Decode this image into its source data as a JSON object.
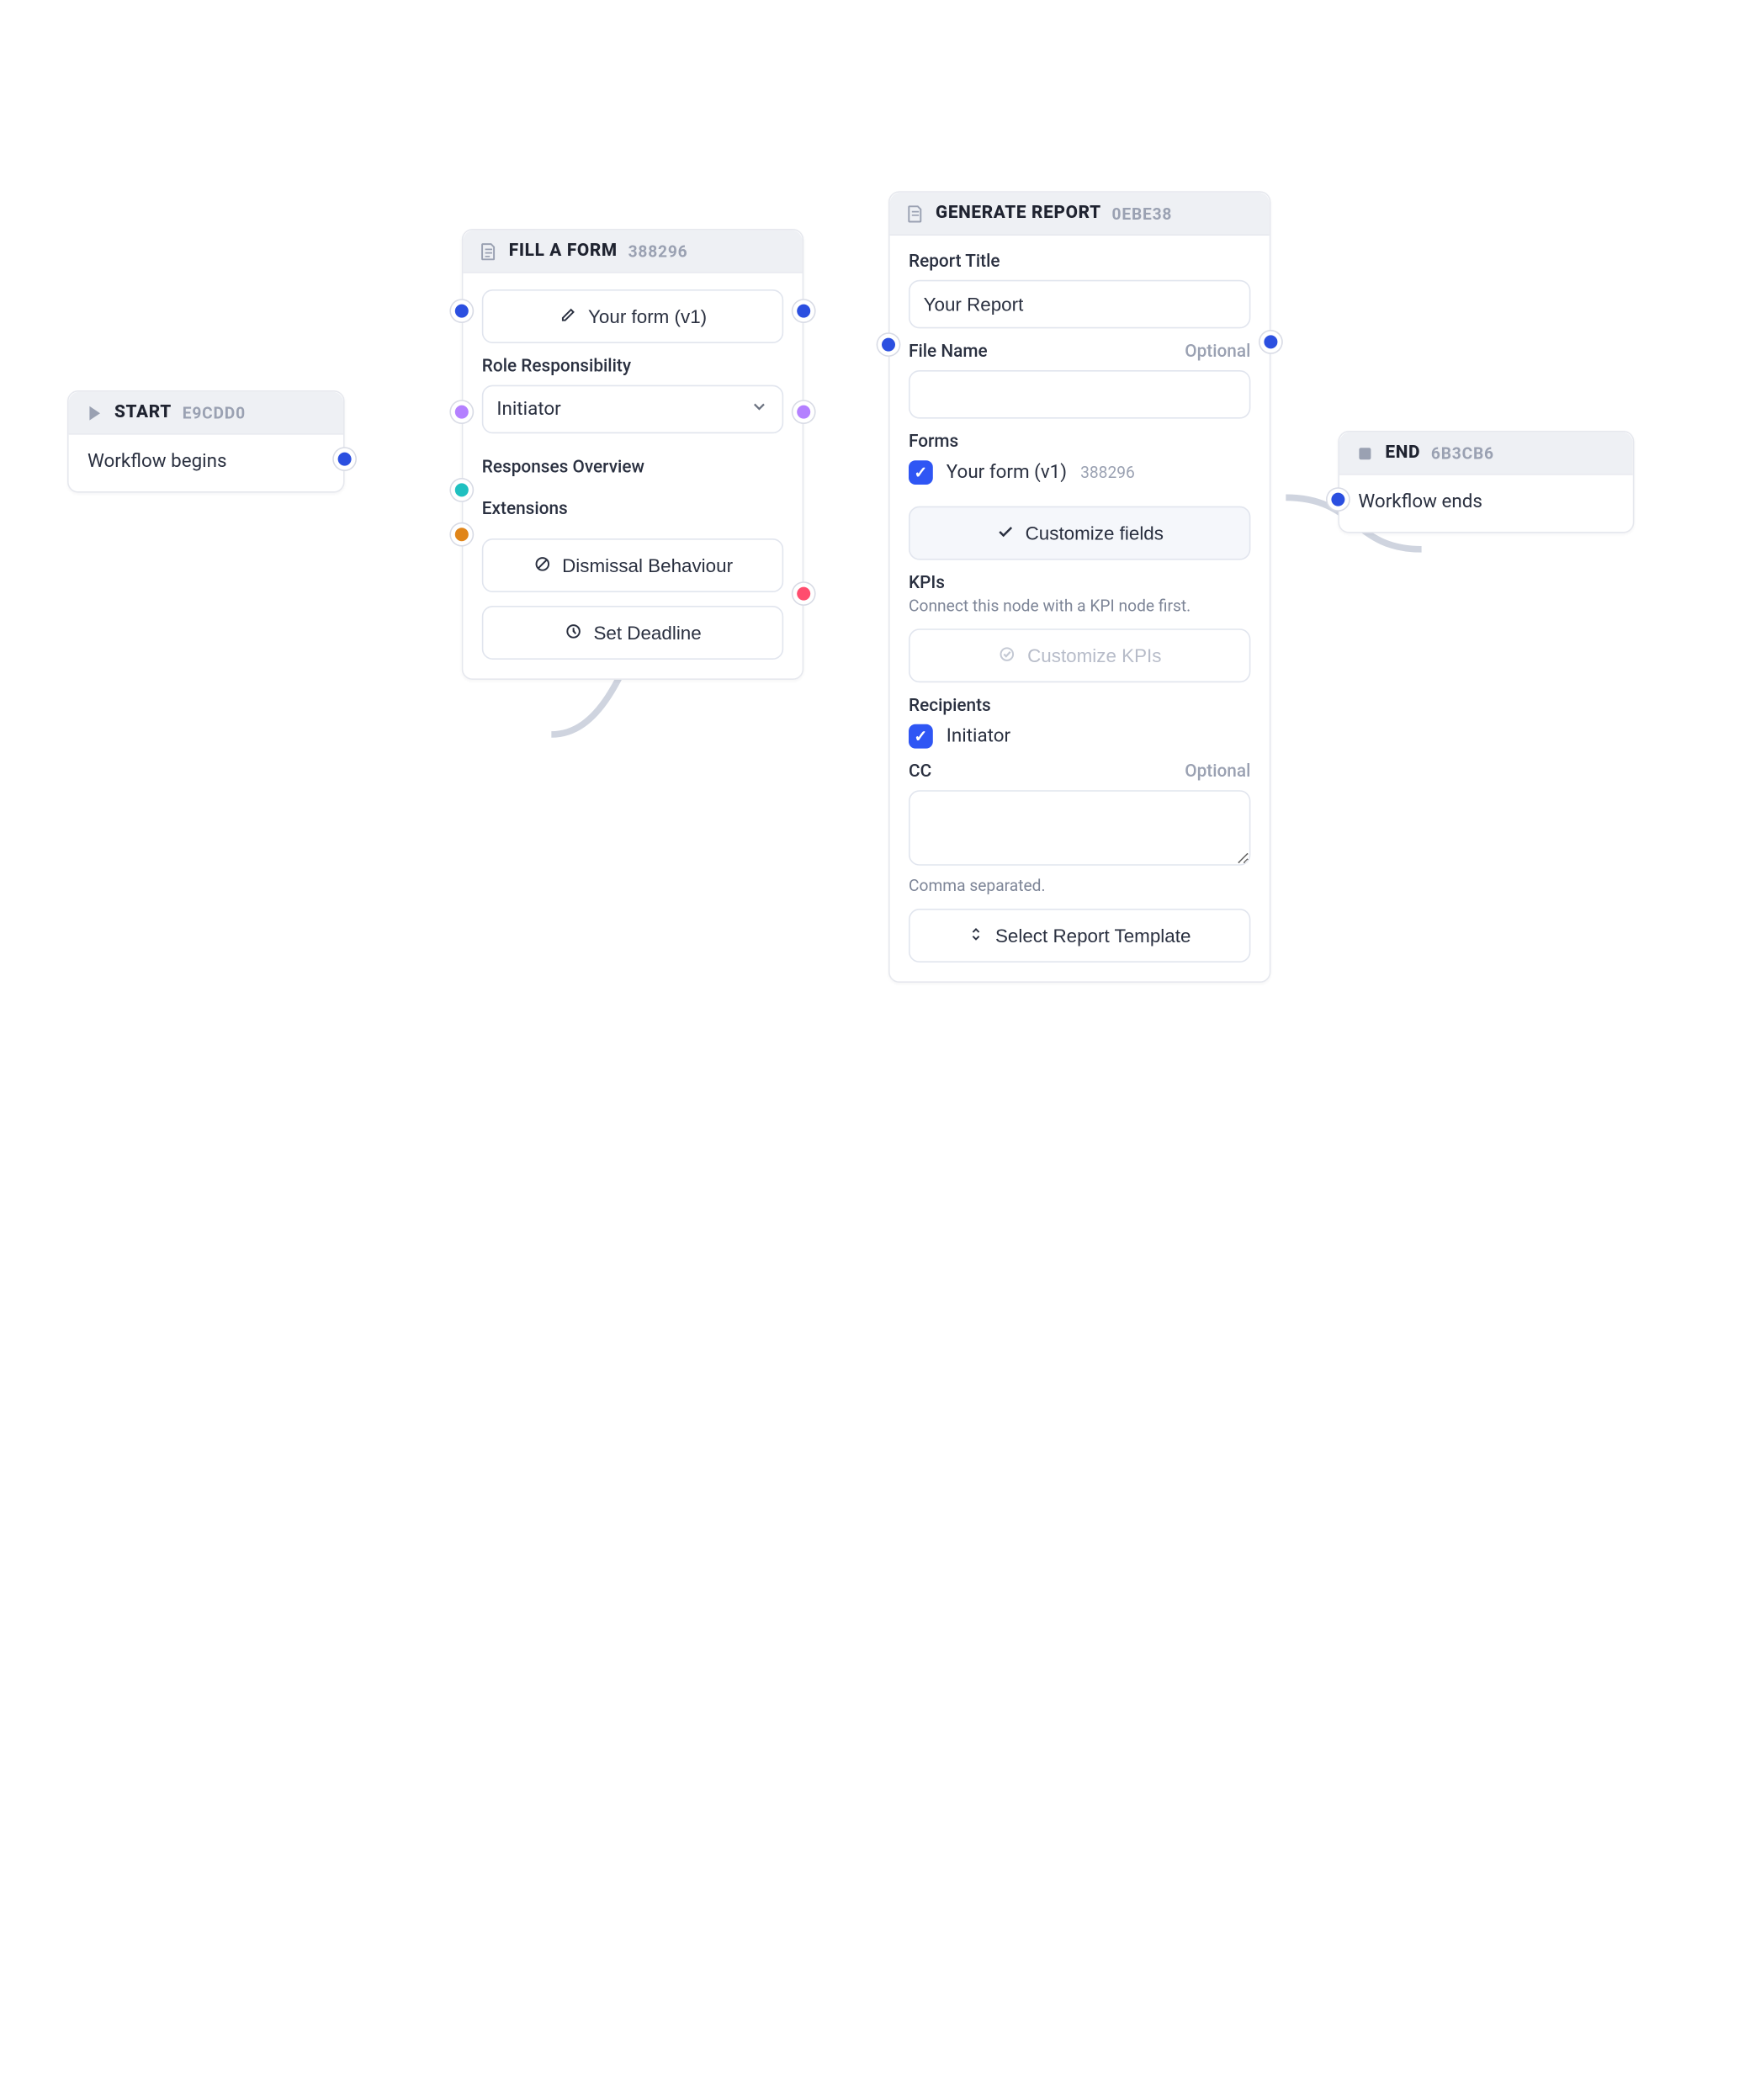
{
  "start": {
    "title": "START",
    "hash": "E9CDD0",
    "body": "Workflow begins"
  },
  "form": {
    "title": "FILL A FORM",
    "hash": "388296",
    "formButton": "Your form (v1)",
    "roleLabel": "Role Responsibility",
    "roleValue": "Initiator",
    "responsesLabel": "Responses Overview",
    "extensionsLabel": "Extensions",
    "dismissalBtn": "Dismissal Behaviour",
    "deadlineBtn": "Set Deadline"
  },
  "gen": {
    "title": "GENERATE REPORT",
    "hash": "0EBE38",
    "reportTitleLabel": "Report Title",
    "reportTitleValue": "Your Report",
    "fileNameLabel": "File Name",
    "fileNameOptional": "Optional",
    "formsLabel": "Forms",
    "formCheckboxLabel": "Your form (v1)",
    "formCheckboxHash": "388296",
    "customizeFieldsBtn": "Customize fields",
    "kpisLabel": "KPIs",
    "kpisHint": "Connect this node with a KPI node first.",
    "customizeKpisBtn": "Customize KPIs",
    "recipientsLabel": "Recipients",
    "recipientInitiator": "Initiator",
    "ccLabel": "CC",
    "ccOptional": "Optional",
    "ccHint": "Comma separated.",
    "selectTemplateBtn": "Select Report Template"
  },
  "end": {
    "title": "END",
    "hash": "6B3CB6",
    "body": "Workflow ends"
  }
}
